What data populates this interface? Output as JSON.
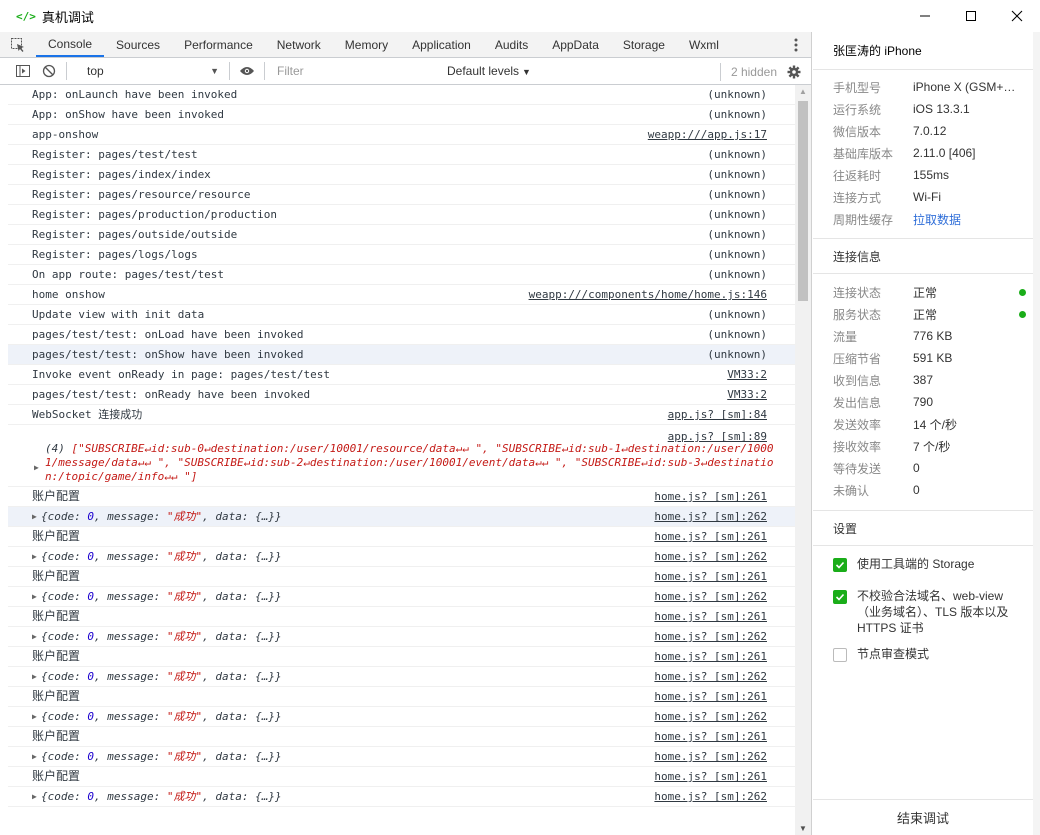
{
  "window": {
    "app_icon": "</>",
    "title": "真机调试",
    "colors": {
      "accent": "#1aad19",
      "tab_underline": "#1a73e8",
      "link": "#2f6ed8",
      "error_text": "#c41a16",
      "number": "#1c00cf"
    }
  },
  "tabs": [
    "Console",
    "Sources",
    "Performance",
    "Network",
    "Memory",
    "Application",
    "Audits",
    "AppData",
    "Storage",
    "Wxml"
  ],
  "active_tab": "Console",
  "toolbar": {
    "context": "top",
    "filter_placeholder": "Filter",
    "levels": "Default levels",
    "hidden": "2 hidden"
  },
  "console": {
    "logs": [
      {
        "msg": "App: onLaunch have been invoked",
        "src": "(unknown)",
        "link": false
      },
      {
        "msg": "App: onShow have been invoked",
        "src": "(unknown)",
        "link": false
      },
      {
        "msg": "app-onshow",
        "src": "weapp:///app.js:17",
        "link": true
      },
      {
        "msg": "Register: pages/test/test",
        "src": "(unknown)",
        "link": false
      },
      {
        "msg": "Register: pages/index/index",
        "src": "(unknown)",
        "link": false
      },
      {
        "msg": "Register: pages/resource/resource",
        "src": "(unknown)",
        "link": false
      },
      {
        "msg": "Register: pages/production/production",
        "src": "(unknown)",
        "link": false
      },
      {
        "msg": "Register: pages/outside/outside",
        "src": "(unknown)",
        "link": false
      },
      {
        "msg": "Register: pages/logs/logs",
        "src": "(unknown)",
        "link": false
      },
      {
        "msg": "On app route: pages/test/test",
        "src": "(unknown)",
        "link": false
      },
      {
        "msg": "home onshow",
        "src": "weapp:///components/home/home.js:146",
        "link": true
      },
      {
        "msg": "Update view with init data",
        "src": "(unknown)",
        "link": false
      },
      {
        "msg": "pages/test/test: onLoad have been invoked",
        "src": "(unknown)",
        "link": false
      },
      {
        "msg": "pages/test/test: onShow have been invoked",
        "src": "(unknown)",
        "link": false,
        "highlight": true
      },
      {
        "msg": "Invoke event onReady in page: pages/test/test",
        "src": "VM33:2",
        "link": true
      },
      {
        "msg": "pages/test/test: onReady have been invoked",
        "src": "VM33:2",
        "link": true
      },
      {
        "msg": "WebSocket 连接成功",
        "src": "app.js? [sm]:84",
        "link": true
      }
    ],
    "array_log": {
      "src": "app.js? [sm]:89",
      "count": "(4)",
      "body": "[\"SUBSCRIBE↵id:sub-0↵destination:/user/10001/resource/data↵↵ \", \"SUBSCRIBE↵id:sub-1↵destination:/user/10001/message/data↵↵ \", \"SUBSCRIBE↵id:sub-2↵destination:/user/10001/event/data↵↵ \", \"SUBSCRIBE↵id:sub-3↵destination:/topic/game/info↵↵ \"]"
    },
    "pair_label": "账户配置",
    "pair_label_src": "home.js? [sm]:261",
    "obj_src": "home.js? [sm]:262",
    "obj": {
      "open": "{code: ",
      "code": "0",
      "mid": ", message: ",
      "message": "\"成功\"",
      "tail": ", data: {…}}"
    },
    "pair_count": 8,
    "first_obj_highlight": true
  },
  "device": {
    "name": "张匡涛的 iPhone",
    "info": [
      {
        "k": "手机型号",
        "v": "iPhone X (GSM+…"
      },
      {
        "k": "运行系统",
        "v": "iOS 13.3.1"
      },
      {
        "k": "微信版本",
        "v": "7.0.12"
      },
      {
        "k": "基础库版本",
        "v": "2.11.0 [406]"
      },
      {
        "k": "往返耗时",
        "v": "155ms"
      },
      {
        "k": "连接方式",
        "v": "Wi-Fi"
      },
      {
        "k": "周期性缓存",
        "v": "拉取数据",
        "link": true
      }
    ],
    "conn_title": "连接信息",
    "conn": [
      {
        "k": "连接状态",
        "v": "正常",
        "dot": true
      },
      {
        "k": "服务状态",
        "v": "正常",
        "dot": true
      },
      {
        "k": "流量",
        "v": "776 KB"
      },
      {
        "k": "压缩节省",
        "v": "591 KB"
      },
      {
        "k": "收到信息",
        "v": "387"
      },
      {
        "k": "发出信息",
        "v": "790"
      },
      {
        "k": "发送效率",
        "v": "14 个/秒"
      },
      {
        "k": "接收效率",
        "v": "7 个/秒"
      },
      {
        "k": "等待发送",
        "v": "0"
      },
      {
        "k": "未确认",
        "v": "0"
      }
    ],
    "settings_title": "设置",
    "settings": [
      {
        "label": "使用工具端的 Storage",
        "checked": true
      },
      {
        "label": "不校验合法域名、web-view（业务域名）、TLS 版本以及 HTTPS 证书",
        "checked": true
      },
      {
        "label": "节点审查模式",
        "checked": false
      }
    ],
    "stop_button": "结束调试"
  }
}
